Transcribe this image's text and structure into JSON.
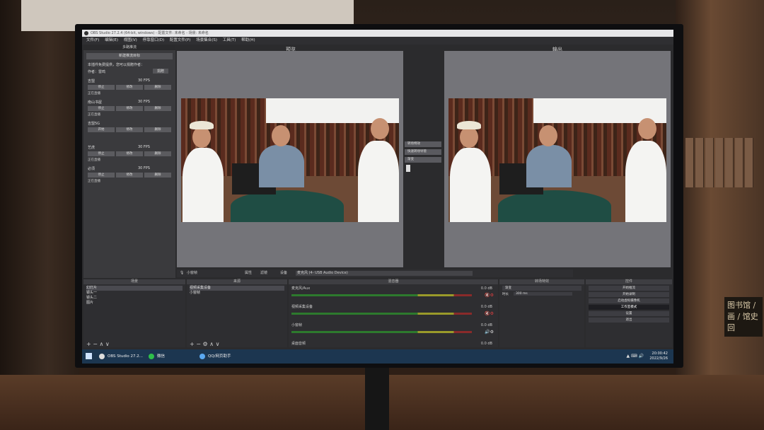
{
  "window": {
    "title": "OBS Studio 27.2.4 (64-bit, windows) - 配置文件: 未命名 - 场景: 未命名"
  },
  "menu": [
    "文件(F)",
    "编辑(E)",
    "视图(V)",
    "停靠窗口(D)",
    "配置文件(P)",
    "场景集合(S)",
    "工具(T)",
    "帮助(H)"
  ],
  "multi_stream": {
    "dock_title": "多路推流",
    "new_target_label": "新建推流目标",
    "info_line1": "本插件免费提供，您可以捐赠作者：",
    "author_label": "作者：雷鸣",
    "donate_label": "捐赠",
    "targets": [
      {
        "name": "吉盟",
        "fps": "30 FPS",
        "buttons": [
          "停止",
          "修改",
          "删除"
        ],
        "status": "正在直播"
      },
      {
        "name": "南山书屋",
        "fps": "30 FPS",
        "buttons": [
          "停止",
          "修改",
          "删除"
        ],
        "status": "正在直播"
      },
      {
        "name": "吉盟5G",
        "fps": "",
        "buttons": [
          "开始",
          "修改",
          "删除"
        ],
        "status": ""
      },
      {
        "name": "艺虎",
        "fps": "30 FPS",
        "buttons": [
          "停止",
          "修改",
          "删除"
        ],
        "status": "正在直播"
      },
      {
        "name": "必须",
        "fps": "30 FPS",
        "buttons": [
          "停止",
          "修改",
          "删除"
        ],
        "status": "正在直播"
      }
    ]
  },
  "preview": {
    "label": "预览"
  },
  "program": {
    "label": "输出"
  },
  "transition": {
    "quick_label": "快速转场",
    "cut_label": "渐变",
    "buttons": [
      "转场特效",
      "快速转场导管",
      "渐变"
    ]
  },
  "scene_bar": {
    "source_label": "小窗帧",
    "properties_label": "属性",
    "filters_label": "滤镜",
    "device_label": "设备",
    "device_value": "麦克风 (4- USB Audio Device)"
  },
  "scenes": {
    "title": "场景",
    "items": [
      "幻灯片",
      "镜头一",
      "镜头二",
      "图片"
    ]
  },
  "sources": {
    "title": "来源",
    "items": [
      "视频采集设备",
      "小窗帧"
    ]
  },
  "mixer": {
    "title": "混音器",
    "channels": [
      {
        "name": "麦克风/Aux",
        "db": "0.0 dB"
      },
      {
        "name": "视频采集设备",
        "db": "0.0 dB"
      },
      {
        "name": "小窗帧",
        "db": "0.0 dB"
      },
      {
        "name": "桌面音频",
        "db": "0.0 dB"
      }
    ]
  },
  "transitions_dock": {
    "title": "转场特效",
    "selected": "渐变",
    "duration_label": "时长",
    "duration_value": "300 ms"
  },
  "controls": {
    "title": "控件",
    "buttons": [
      "开始推流",
      "开始录制",
      "启动虚拟摄像机",
      "工作室模式",
      "设置",
      "退出"
    ],
    "active_index": 3
  },
  "taskbar": {
    "items": [
      "OBS Studio 27.2...",
      "微信",
      "QQ/网页助手"
    ],
    "time": "20:00:42",
    "date": "2022/9/26"
  },
  "background": {
    "sign_text": "图书馆 / 画 / 馆史回"
  }
}
